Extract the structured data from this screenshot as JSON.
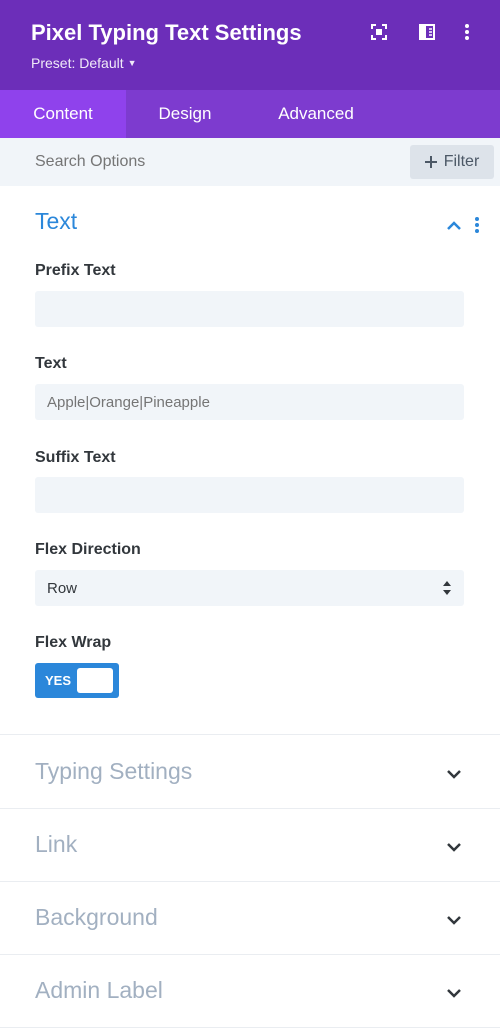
{
  "header": {
    "title": "Pixel Typing Text Settings",
    "preset_label": "Preset: Default",
    "icons": [
      "focus-icon",
      "sidebar-toggle-icon",
      "more-options-icon"
    ]
  },
  "tabs": [
    {
      "label": "Content",
      "active": true
    },
    {
      "label": "Design",
      "active": false
    },
    {
      "label": "Advanced",
      "active": false
    }
  ],
  "search": {
    "placeholder": "Search Options",
    "filter_label": "Filter"
  },
  "text_section": {
    "title": "Text",
    "fields": {
      "prefix_text": {
        "label": "Prefix Text",
        "value": "",
        "placeholder": ""
      },
      "text": {
        "label": "Text",
        "value": "",
        "placeholder": "Apple|Orange|Pineapple"
      },
      "suffix_text": {
        "label": "Suffix Text",
        "value": "",
        "placeholder": ""
      },
      "flex_direction": {
        "label": "Flex Direction",
        "value": "Row"
      },
      "flex_wrap": {
        "label": "Flex Wrap",
        "value": "YES",
        "on": true
      }
    }
  },
  "sections": [
    {
      "title": "Typing Settings"
    },
    {
      "title": "Link"
    },
    {
      "title": "Background"
    },
    {
      "title": "Admin Label"
    }
  ],
  "colors": {
    "header_bg": "#6c2eb9",
    "tabs_bg": "#7d3bcf",
    "active_tab_bg": "#8f42ec",
    "accent_blue": "#2b87da",
    "input_bg": "#f1f5f9",
    "collapsed_title": "#a2b0c1"
  }
}
